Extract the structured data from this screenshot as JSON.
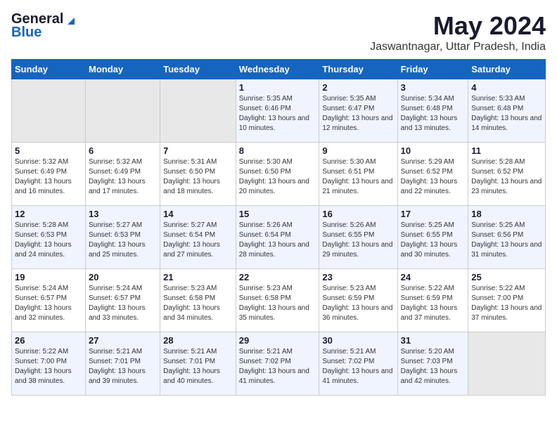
{
  "logo": {
    "general": "General",
    "blue": "Blue"
  },
  "title": "May 2024",
  "location": "Jaswantnagar, Uttar Pradesh, India",
  "weekdays": [
    "Sunday",
    "Monday",
    "Tuesday",
    "Wednesday",
    "Thursday",
    "Friday",
    "Saturday"
  ],
  "weeks": [
    [
      {
        "day": "",
        "sunrise": "",
        "sunset": "",
        "daylight": ""
      },
      {
        "day": "",
        "sunrise": "",
        "sunset": "",
        "daylight": ""
      },
      {
        "day": "",
        "sunrise": "",
        "sunset": "",
        "daylight": ""
      },
      {
        "day": "1",
        "sunrise": "5:35 AM",
        "sunset": "6:46 PM",
        "daylight": "13 hours and 10 minutes."
      },
      {
        "day": "2",
        "sunrise": "5:35 AM",
        "sunset": "6:47 PM",
        "daylight": "13 hours and 12 minutes."
      },
      {
        "day": "3",
        "sunrise": "5:34 AM",
        "sunset": "6:48 PM",
        "daylight": "13 hours and 13 minutes."
      },
      {
        "day": "4",
        "sunrise": "5:33 AM",
        "sunset": "6:48 PM",
        "daylight": "13 hours and 14 minutes."
      }
    ],
    [
      {
        "day": "5",
        "sunrise": "5:32 AM",
        "sunset": "6:49 PM",
        "daylight": "13 hours and 16 minutes."
      },
      {
        "day": "6",
        "sunrise": "5:32 AM",
        "sunset": "6:49 PM",
        "daylight": "13 hours and 17 minutes."
      },
      {
        "day": "7",
        "sunrise": "5:31 AM",
        "sunset": "6:50 PM",
        "daylight": "13 hours and 18 minutes."
      },
      {
        "day": "8",
        "sunrise": "5:30 AM",
        "sunset": "6:50 PM",
        "daylight": "13 hours and 20 minutes."
      },
      {
        "day": "9",
        "sunrise": "5:30 AM",
        "sunset": "6:51 PM",
        "daylight": "13 hours and 21 minutes."
      },
      {
        "day": "10",
        "sunrise": "5:29 AM",
        "sunset": "6:52 PM",
        "daylight": "13 hours and 22 minutes."
      },
      {
        "day": "11",
        "sunrise": "5:28 AM",
        "sunset": "6:52 PM",
        "daylight": "13 hours and 23 minutes."
      }
    ],
    [
      {
        "day": "12",
        "sunrise": "5:28 AM",
        "sunset": "6:53 PM",
        "daylight": "13 hours and 24 minutes."
      },
      {
        "day": "13",
        "sunrise": "5:27 AM",
        "sunset": "6:53 PM",
        "daylight": "13 hours and 25 minutes."
      },
      {
        "day": "14",
        "sunrise": "5:27 AM",
        "sunset": "6:54 PM",
        "daylight": "13 hours and 27 minutes."
      },
      {
        "day": "15",
        "sunrise": "5:26 AM",
        "sunset": "6:54 PM",
        "daylight": "13 hours and 28 minutes."
      },
      {
        "day": "16",
        "sunrise": "5:26 AM",
        "sunset": "6:55 PM",
        "daylight": "13 hours and 29 minutes."
      },
      {
        "day": "17",
        "sunrise": "5:25 AM",
        "sunset": "6:55 PM",
        "daylight": "13 hours and 30 minutes."
      },
      {
        "day": "18",
        "sunrise": "5:25 AM",
        "sunset": "6:56 PM",
        "daylight": "13 hours and 31 minutes."
      }
    ],
    [
      {
        "day": "19",
        "sunrise": "5:24 AM",
        "sunset": "6:57 PM",
        "daylight": "13 hours and 32 minutes."
      },
      {
        "day": "20",
        "sunrise": "5:24 AM",
        "sunset": "6:57 PM",
        "daylight": "13 hours and 33 minutes."
      },
      {
        "day": "21",
        "sunrise": "5:23 AM",
        "sunset": "6:58 PM",
        "daylight": "13 hours and 34 minutes."
      },
      {
        "day": "22",
        "sunrise": "5:23 AM",
        "sunset": "6:58 PM",
        "daylight": "13 hours and 35 minutes."
      },
      {
        "day": "23",
        "sunrise": "5:23 AM",
        "sunset": "6:59 PM",
        "daylight": "13 hours and 36 minutes."
      },
      {
        "day": "24",
        "sunrise": "5:22 AM",
        "sunset": "6:59 PM",
        "daylight": "13 hours and 37 minutes."
      },
      {
        "day": "25",
        "sunrise": "5:22 AM",
        "sunset": "7:00 PM",
        "daylight": "13 hours and 37 minutes."
      }
    ],
    [
      {
        "day": "26",
        "sunrise": "5:22 AM",
        "sunset": "7:00 PM",
        "daylight": "13 hours and 38 minutes."
      },
      {
        "day": "27",
        "sunrise": "5:21 AM",
        "sunset": "7:01 PM",
        "daylight": "13 hours and 39 minutes."
      },
      {
        "day": "28",
        "sunrise": "5:21 AM",
        "sunset": "7:01 PM",
        "daylight": "13 hours and 40 minutes."
      },
      {
        "day": "29",
        "sunrise": "5:21 AM",
        "sunset": "7:02 PM",
        "daylight": "13 hours and 41 minutes."
      },
      {
        "day": "30",
        "sunrise": "5:21 AM",
        "sunset": "7:02 PM",
        "daylight": "13 hours and 41 minutes."
      },
      {
        "day": "31",
        "sunrise": "5:20 AM",
        "sunset": "7:03 PM",
        "daylight": "13 hours and 42 minutes."
      },
      {
        "day": "",
        "sunrise": "",
        "sunset": "",
        "daylight": ""
      }
    ]
  ],
  "labels": {
    "sunrise": "Sunrise:",
    "sunset": "Sunset:",
    "daylight": "Daylight:"
  }
}
